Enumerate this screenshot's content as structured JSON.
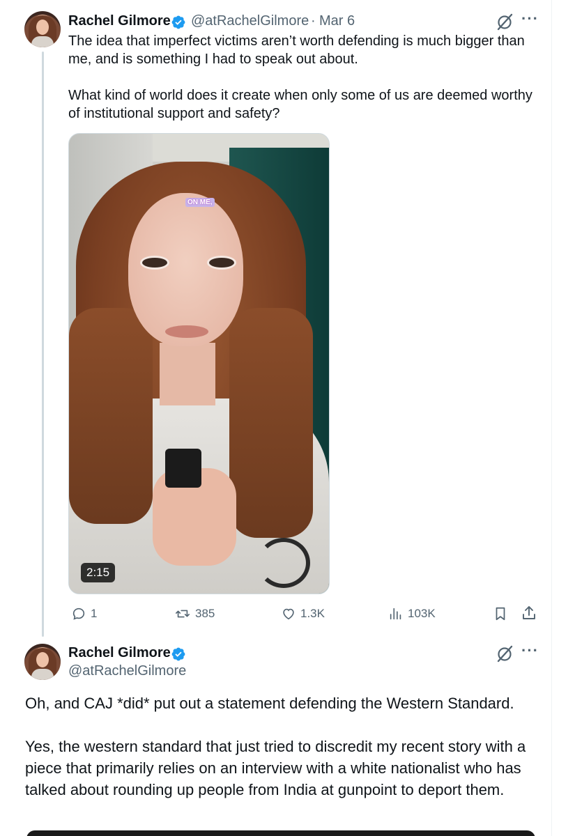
{
  "tweet1": {
    "name": "Rachel Gilmore",
    "handle": "@atRachelGilmore",
    "date_sep": "·",
    "date": "Mar 6",
    "text": "The idea that imperfect victims aren’t worth defending is much bigger than me, and is something I had to speak out about.\n\nWhat kind of world does it create when only some of us are deemed worthy of institutional support and safety?",
    "video": {
      "caption_overlay": "ON ME,",
      "duration": "2:15"
    },
    "actions": {
      "replies": "1",
      "reposts": "385",
      "likes": "1.3K",
      "views": "103K"
    }
  },
  "tweet2": {
    "name": "Rachel Gilmore",
    "handle": "@atRachelGilmore",
    "paragraph1": "Oh, and CAJ *did* put out a statement defending the Western Standard.",
    "paragraph2": "Yes, the western standard that just tried to discredit my recent story with a piece that primarily relies on an interview with a white nationalist who has talked about rounding up people from India at gunpoint to deport them."
  },
  "icons": {
    "more": "more-icon",
    "grok": "grok-icon",
    "verified": "verified-badge-icon",
    "reply": "reply-icon",
    "repost": "repost-icon",
    "like": "like-icon",
    "views": "views-icon",
    "bookmark": "bookmark-icon",
    "share": "share-icon"
  },
  "colors": {
    "text": "#0f1419",
    "secondary": "#536471",
    "verified": "#1d9bf0",
    "thread_line": "#cfd9de"
  }
}
